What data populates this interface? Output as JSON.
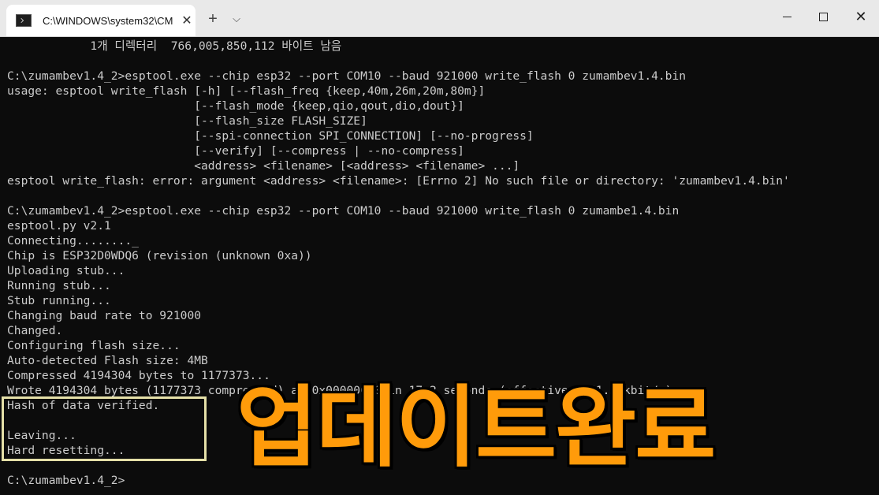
{
  "window": {
    "tab_title": "C:\\WINDOWS\\system32\\CM",
    "tab_close": "✕",
    "new_tab": "+",
    "dropdown": "⌵",
    "close": "✕"
  },
  "console": {
    "lines": [
      "            1개 디렉터리  766,005,850,112 바이트 남음",
      "",
      "C:\\zumambev1.4_2>esptool.exe --chip esp32 --port COM10 --baud 921000 write_flash 0 zumambev1.4.bin",
      "usage: esptool write_flash [-h] [--flash_freq {keep,40m,26m,20m,80m}]",
      "                           [--flash_mode {keep,qio,qout,dio,dout}]",
      "                           [--flash_size FLASH_SIZE]",
      "                           [--spi-connection SPI_CONNECTION] [--no-progress]",
      "                           [--verify] [--compress | --no-compress]",
      "                           <address> <filename> [<address> <filename> ...]",
      "esptool write_flash: error: argument <address> <filename>: [Errno 2] No such file or directory: 'zumambev1.4.bin'",
      "",
      "C:\\zumambev1.4_2>esptool.exe --chip esp32 --port COM10 --baud 921000 write_flash 0 zumambe1.4.bin",
      "esptool.py v2.1",
      "Connecting........_",
      "Chip is ESP32D0WDQ6 (revision (unknown 0xa))",
      "Uploading stub...",
      "Running stub...",
      "Stub running...",
      "Changing baud rate to 921000",
      "Changed.",
      "Configuring flash size...",
      "Auto-detected Flash size: 4MB",
      "Compressed 4194304 bytes to 1177373...",
      "Wrote 4194304 bytes (1177373 compressed) at 0x00000000 in 17.2 seconds (effective 1951.5 kbit/s)...",
      "Hash of data verified.",
      "",
      "Leaving...",
      "Hard resetting...",
      "",
      "C:\\zumambev1.4_2>"
    ]
  },
  "overlay": {
    "text": "업데이트완료"
  }
}
